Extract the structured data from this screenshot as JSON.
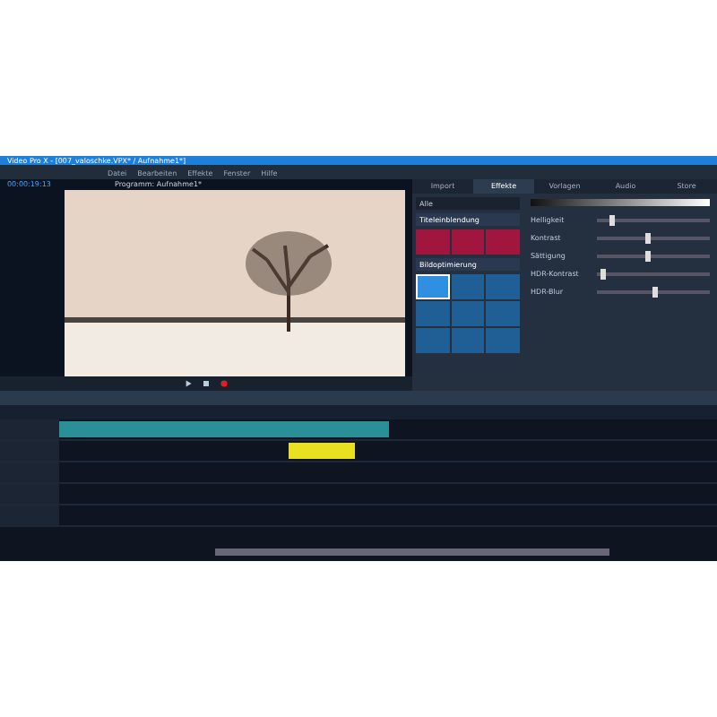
{
  "window": {
    "title": "Video Pro X - [007_valoschke.VPX* / Aufnahme1*]"
  },
  "menu": [
    "Datei",
    "Bearbeiten",
    "Effekte",
    "Fenster",
    "Hilfe"
  ],
  "monitor": {
    "title": "Programm: Aufnahme1*",
    "timecode": "00:00:19:13"
  },
  "panel_tabs": [
    {
      "label": "Import",
      "selected": false
    },
    {
      "label": "Effekte",
      "selected": true
    },
    {
      "label": "Vorlagen",
      "selected": false
    },
    {
      "label": "Audio",
      "selected": false
    },
    {
      "label": "Store",
      "selected": false
    }
  ],
  "effect_filter": "Alle",
  "sections": [
    {
      "title": "Titeleinblendung",
      "tiles": [
        {
          "color": "#a0163e",
          "selected": false
        },
        {
          "color": "#a0163e",
          "selected": false
        },
        {
          "color": "#a0163e",
          "selected": false
        }
      ]
    },
    {
      "title": "Bildoptimierung",
      "tiles": [
        {
          "color": "#2f8fe0",
          "selected": true
        },
        {
          "color": "#1f5f96",
          "selected": false
        },
        {
          "color": "#1f5f96",
          "selected": false
        },
        {
          "color": "#1f5f96",
          "selected": false
        },
        {
          "color": "#1f5f96",
          "selected": false
        },
        {
          "color": "#1f5f96",
          "selected": false
        },
        {
          "color": "#1f5f96",
          "selected": false
        },
        {
          "color": "#1f5f96",
          "selected": false
        },
        {
          "color": "#1f5f96",
          "selected": false
        }
      ]
    }
  ],
  "properties": [
    {
      "label": "Helligkeit",
      "level": 0.12
    },
    {
      "label": "Kontrast",
      "level": 0.45
    },
    {
      "label": "Sättigung",
      "level": 0.45
    },
    {
      "label": "HDR-Kontrast",
      "level": 0.05
    },
    {
      "label": "HDR-Blur",
      "level": 0.5
    }
  ],
  "timeline": {
    "clips": [
      {
        "color": "#2a8f96"
      },
      {
        "color": "#e8e020"
      }
    ]
  }
}
